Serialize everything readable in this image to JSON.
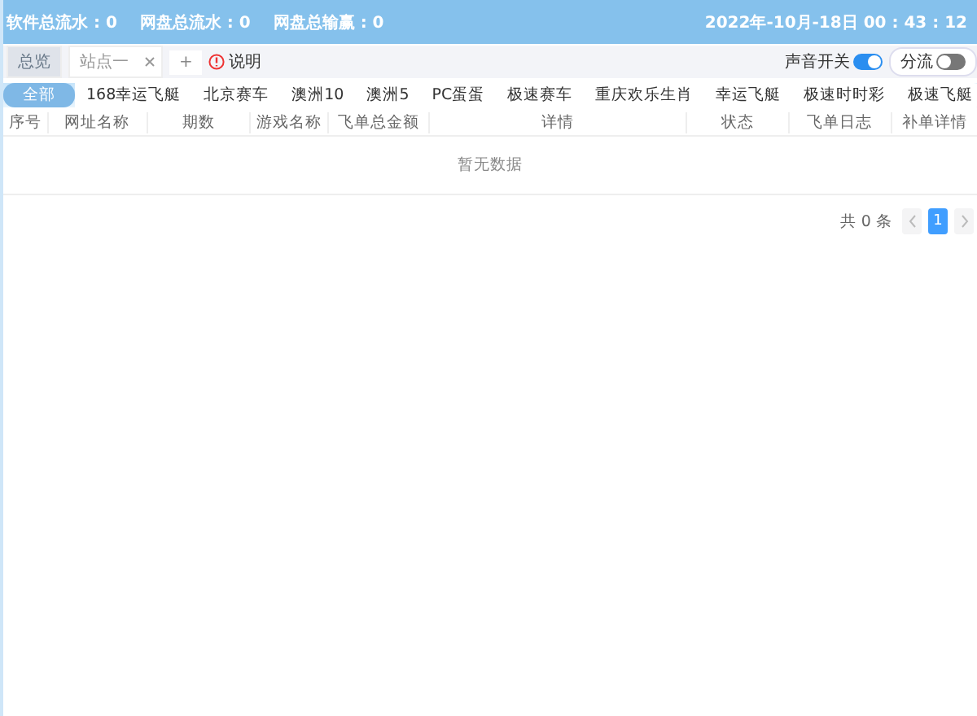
{
  "header": {
    "stats": [
      "软件总流水 : 0",
      "网盘总流水 : 0",
      "网盘总输赢 : 0"
    ],
    "datetime": "2022年-10月-18日 00 : 43 : 12"
  },
  "tabs": [
    {
      "label": "总览",
      "closable": false,
      "selected": false
    },
    {
      "label": "站点一",
      "closable": true,
      "selected": true
    }
  ],
  "add_tab": "+",
  "help": "说明",
  "toggles": [
    {
      "label": "声音开关",
      "on": true
    },
    {
      "label": "分流",
      "on": false
    }
  ],
  "categories": [
    {
      "label": "全部",
      "selected": true
    },
    {
      "label": "168幸运飞艇",
      "selected": false
    },
    {
      "label": "北京赛车",
      "selected": false
    },
    {
      "label": "澳洲10",
      "selected": false
    },
    {
      "label": "澳洲5",
      "selected": false
    },
    {
      "label": "PC蛋蛋",
      "selected": false
    },
    {
      "label": "极速赛车",
      "selected": false
    },
    {
      "label": "重庆欢乐生肖",
      "selected": false
    },
    {
      "label": "幸运飞艇",
      "selected": false
    },
    {
      "label": "极速时时彩",
      "selected": false
    },
    {
      "label": "极速飞艇",
      "selected": false
    }
  ],
  "table": {
    "columns": [
      "序号",
      "网址名称",
      "期数",
      "游戏名称",
      "飞单总金额",
      "详情",
      "状态",
      "飞单日志",
      "补单详情"
    ],
    "empty_text": "暂无数据"
  },
  "pagination": {
    "total": "共 0 条",
    "pages": [
      {
        "label": "1",
        "selected": true
      }
    ]
  }
}
